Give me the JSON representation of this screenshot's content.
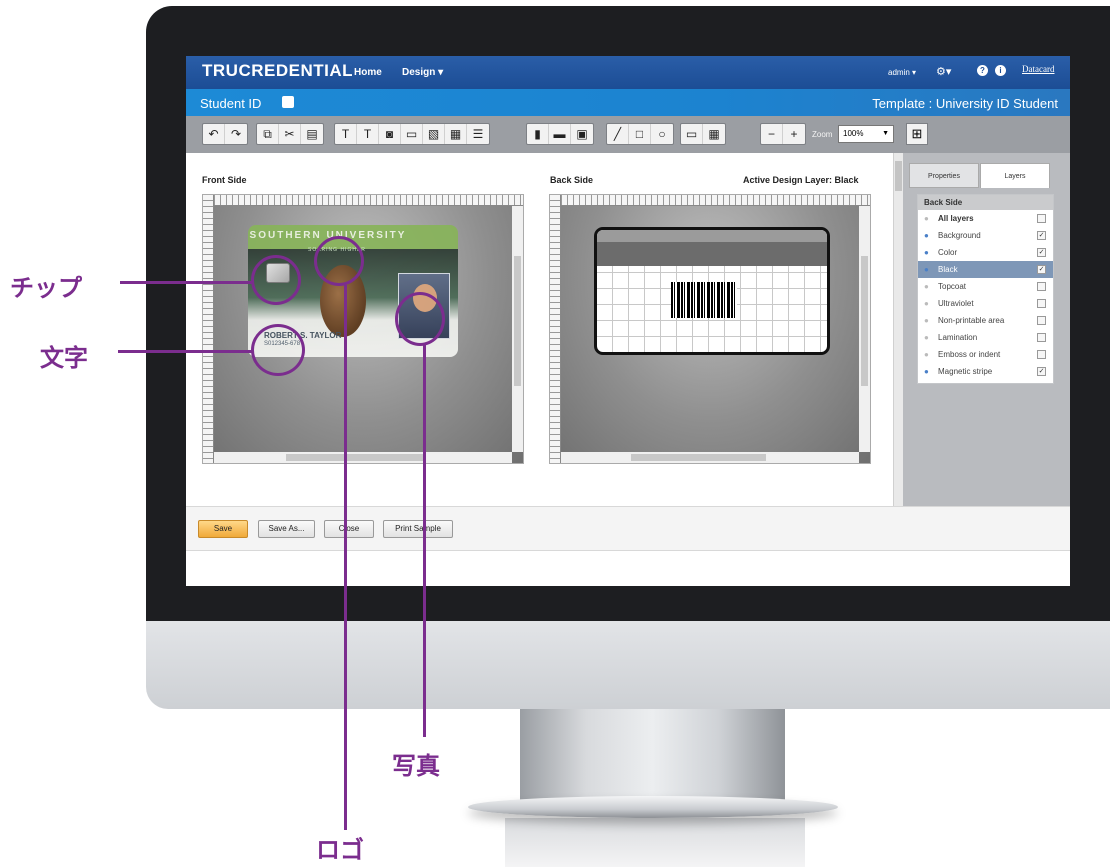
{
  "app": {
    "logo": "TRUCREDENTIAL",
    "nav": {
      "home": "Home",
      "design": "Design ▾",
      "admin": "admin ▾",
      "brand": "Datacard"
    },
    "doc_title": "Student ID",
    "template_label": "Template : University ID Student"
  },
  "toolbar": {
    "icons": [
      "undo-icon",
      "redo-icon",
      "copy-icon",
      "cut-icon",
      "paste-icon",
      "text-box-icon",
      "text-icon",
      "photo-field-icon",
      "image-icon",
      "image-edit-icon",
      "card-icon",
      "layout-icon",
      "barcode-icon",
      "magstripe-icon",
      "grid-field-icon",
      "line-icon",
      "rectangle-icon",
      "ellipse-icon",
      "ruler-icon",
      "grid-icon",
      "zoom-out-icon",
      "zoom-in-icon"
    ],
    "zoom_label": "Zoom",
    "zoom_value": "100%"
  },
  "front": {
    "title": "Front Side"
  },
  "back": {
    "title": "Back Side",
    "active_layer": "Active Design Layer: Black"
  },
  "card_front": {
    "university": "SOUTHERN UNIVERSITY",
    "tagline": "SOARING HIGHER",
    "name": "ROBERT S. TAYLOR",
    "id": "S012345-678"
  },
  "sidepanel": {
    "tabs": [
      "Properties",
      "Layers"
    ],
    "layers_header": "Back Side",
    "layers": [
      {
        "label": "All layers",
        "visible": false,
        "checked": false,
        "bold": true
      },
      {
        "label": "Background",
        "visible": true,
        "checked": true
      },
      {
        "label": "Color",
        "visible": true,
        "checked": true
      },
      {
        "label": "Black",
        "visible": true,
        "checked": true,
        "active": true
      },
      {
        "label": "Topcoat",
        "visible": false,
        "checked": false
      },
      {
        "label": "Ultraviolet",
        "visible": false,
        "checked": false
      },
      {
        "label": "Non-printable area",
        "visible": false,
        "checked": false
      },
      {
        "label": "Lamination",
        "visible": false,
        "checked": false
      },
      {
        "label": "Emboss or indent",
        "visible": false,
        "checked": false
      },
      {
        "label": "Magnetic stripe",
        "visible": true,
        "checked": true
      }
    ]
  },
  "footer": {
    "save": "Save",
    "save_as": "Save As...",
    "close": "Close",
    "print": "Print Sample"
  },
  "annotations": {
    "chip": "チップ",
    "text": "文字",
    "photo": "写真",
    "logo": "ロゴ"
  },
  "colors": {
    "annotation": "#7b2d8e",
    "nav_blue": "#1c4d95",
    "sub_blue": "#1d8ad6",
    "save_orange": "#f0a93a"
  }
}
